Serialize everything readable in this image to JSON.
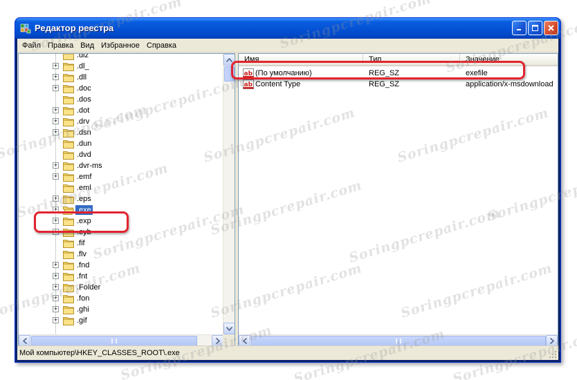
{
  "window": {
    "title": "Редактор реестра"
  },
  "menu": {
    "items": [
      "Файл",
      "Правка",
      "Вид",
      "Избранное",
      "Справка"
    ]
  },
  "tree": {
    "nodes": [
      {
        "label": ".diz",
        "expandable": false
      },
      {
        "label": ".dl_",
        "expandable": true
      },
      {
        "label": ".dll",
        "expandable": true
      },
      {
        "label": ".doc",
        "expandable": true
      },
      {
        "label": ".dos",
        "expandable": false
      },
      {
        "label": ".dot",
        "expandable": true
      },
      {
        "label": ".drv",
        "expandable": true
      },
      {
        "label": ".dsn",
        "expandable": true
      },
      {
        "label": ".dun",
        "expandable": false
      },
      {
        "label": ".dvd",
        "expandable": false
      },
      {
        "label": ".dvr-ms",
        "expandable": true
      },
      {
        "label": ".emf",
        "expandable": true
      },
      {
        "label": ".eml",
        "expandable": false
      },
      {
        "label": ".eps",
        "expandable": true
      },
      {
        "label": ".exe",
        "expandable": true,
        "selected": true
      },
      {
        "label": ".exp",
        "expandable": true
      },
      {
        "label": ".eyb",
        "expandable": true
      },
      {
        "label": ".fif",
        "expandable": false
      },
      {
        "label": ".flv",
        "expandable": false
      },
      {
        "label": ".fnd",
        "expandable": true
      },
      {
        "label": ".fnt",
        "expandable": true
      },
      {
        "label": ".Folder",
        "expandable": true
      },
      {
        "label": ".fon",
        "expandable": true
      },
      {
        "label": ".ghi",
        "expandable": true
      },
      {
        "label": ".gif",
        "expandable": true
      }
    ]
  },
  "list": {
    "columns": [
      "Имя",
      "Тип",
      "Значение"
    ],
    "rows": [
      {
        "name": "(По умолчанию)",
        "type": "REG_SZ",
        "value": "exefile"
      },
      {
        "name": "Content Type",
        "type": "REG_SZ",
        "value": "application/x-msdownload"
      }
    ]
  },
  "status": {
    "path": "Мой компьютер\\HKEY_CLASSES_ROOT\\.exe"
  },
  "watermark": "Soringpcrepair.com",
  "colors": {
    "selection": "#316ac5",
    "callout": "#e3232f",
    "titlebar": "#0553d6"
  }
}
